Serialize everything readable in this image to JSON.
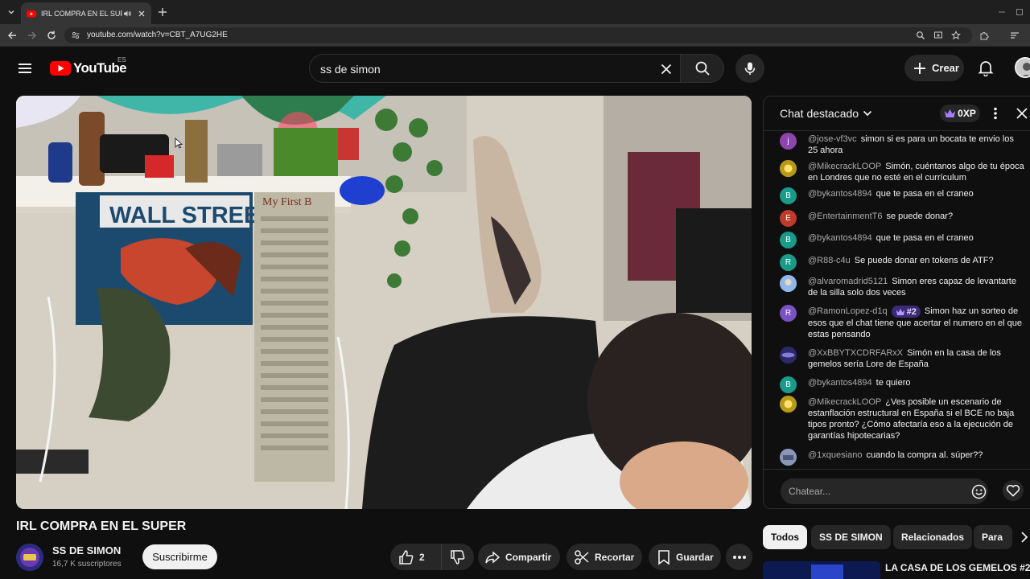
{
  "browser": {
    "tab_title": "IRL COMPRA EN EL SUPER",
    "url": "youtube.com/watch?v=CBT_A7UG2HE"
  },
  "header": {
    "logo_text": "YouTube",
    "region": "ES",
    "search_query": "ss de simon",
    "create_label": "Crear"
  },
  "video": {
    "title": "IRL COMPRA EN EL SUPER",
    "channel_name": "SS DE SIMON",
    "subscribers": "16,7 K suscriptores",
    "subscribe_label": "Suscribirme",
    "like_count": "2",
    "share_label": "Compartir",
    "clip_label": "Recortar",
    "save_label": "Guardar",
    "scene_sign_1": "WALL STREET",
    "scene_sign_2": "My First B"
  },
  "chat": {
    "title": "Chat destacado",
    "xp_label": "0XP",
    "input_placeholder": "Chatear...",
    "messages": [
      {
        "author": "@jose-vf3vc",
        "text": "simon si es para un bocata te envio los 25 ahora",
        "avatar_letter": "j",
        "avatar_color": "#8e44ad"
      },
      {
        "author": "@MikecrackLOOP",
        "text": "Simón, cuéntanos algo de tu época en Londres que no esté en el currículum",
        "avatar_letter": "",
        "avatar_color": "#d4b106"
      },
      {
        "author": "@bykantos4894",
        "text": "que te pasa en el craneo",
        "avatar_letter": "B",
        "avatar_color": "#1a9b8a"
      },
      {
        "author": "@EntertainmentT6",
        "text": "se puede donar?",
        "avatar_letter": "E",
        "avatar_color": "#c0392b"
      },
      {
        "author": "@bykantos4894",
        "text": "que te pasa en el craneo",
        "avatar_letter": "B",
        "avatar_color": "#1a9b8a"
      },
      {
        "author": "@R88-c4u",
        "text": "Se puede donar en tokens de ATF?",
        "avatar_letter": "R",
        "avatar_color": "#1a9b8a"
      },
      {
        "author": "@alvaromadrid5121",
        "text": "Simon eres capaz de levantarte de la silla solo dos veces",
        "avatar_letter": "",
        "avatar_color": "#6a9fd4"
      },
      {
        "author": "@RamonLopez-d1q",
        "badge": "#2",
        "text": "Simon haz un sorteo de esos que el chat tiene que acertar el numero en el que estas pensando",
        "avatar_letter": "R",
        "avatar_color": "#7b52c4"
      },
      {
        "author": "@XxBBYTXCDRFARxX",
        "text": "Simón en la casa de los gemelos sería Lore de España",
        "avatar_letter": "",
        "avatar_color": "#3a3a8a"
      },
      {
        "author": "@bykantos4894",
        "text": "te quiero",
        "avatar_letter": "B",
        "avatar_color": "#1a9b8a"
      },
      {
        "author": "@MikecrackLOOP",
        "text": "¿Ves posible un escenario de estanflación estructural en España si el BCE no baja tipos pronto? ¿Cómo afectaría eso a la ejecución de garantías hipotecarias?",
        "avatar_letter": "",
        "avatar_color": "#d4b106"
      },
      {
        "author": "@1xquesiano",
        "text": "cuando la compra al. súper??",
        "avatar_letter": "",
        "avatar_color": "#7a86a8"
      }
    ]
  },
  "chips": [
    "Todos",
    "SS DE SIMON",
    "Relacionados",
    "Para"
  ],
  "related": {
    "title": "LA CASA DE LOS GEMELOS #2 |"
  },
  "colors": {
    "background": "#0f0f0f",
    "youtube_red": "#ff0000",
    "chip_bg": "#272727"
  }
}
